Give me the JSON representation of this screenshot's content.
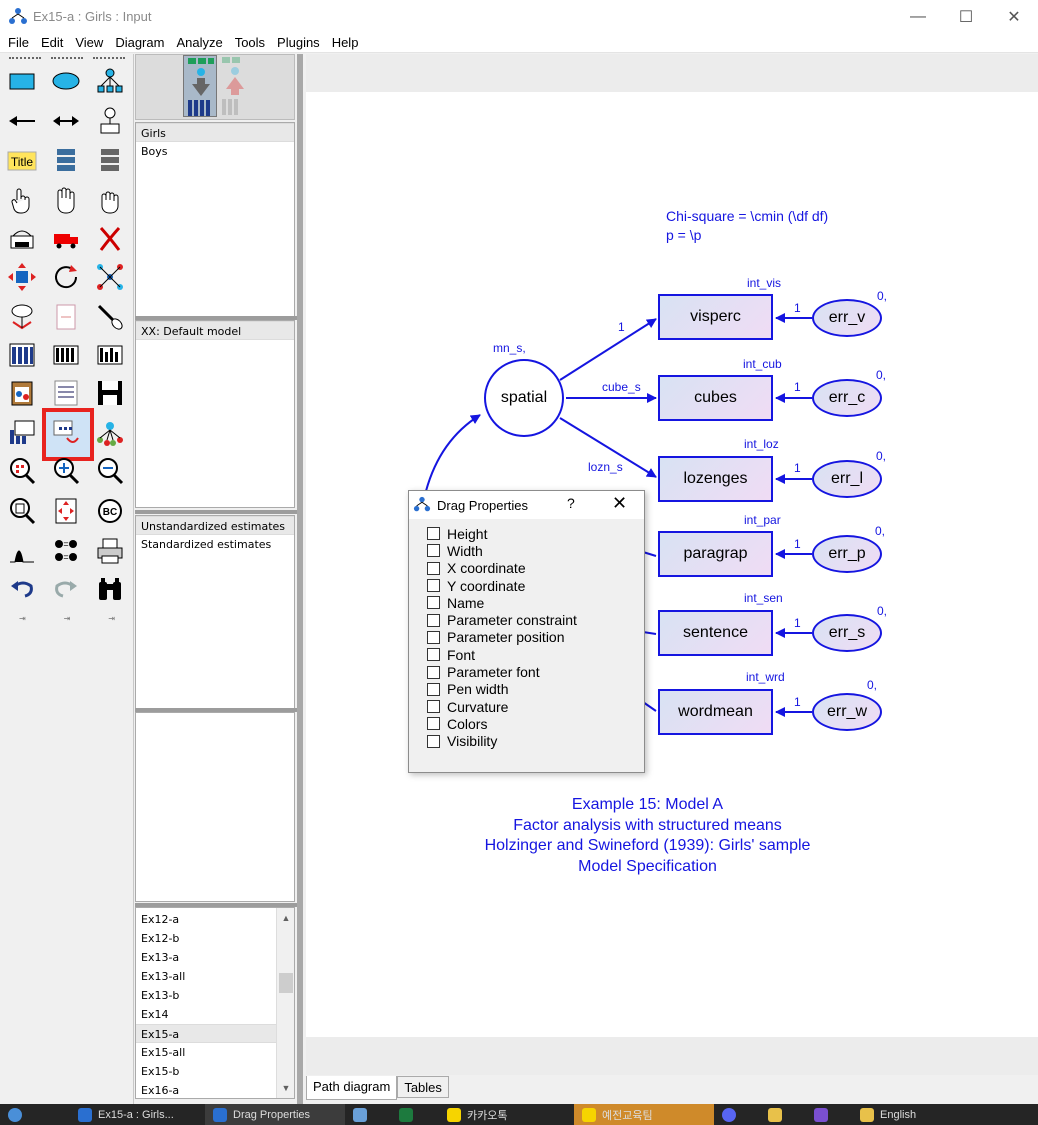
{
  "window": {
    "title": "Ex15-a : Girls : Input",
    "minimize": "—",
    "maximize": "☐",
    "close": "✕"
  },
  "menu": [
    "File",
    "Edit",
    "View",
    "Diagram",
    "Analyze",
    "Tools",
    "Plugins",
    "Help"
  ],
  "toolbox": {
    "title_tool_label": "Title",
    "bcd_tool_label": "BC"
  },
  "groups": {
    "items": [
      "Girls",
      "Boys"
    ]
  },
  "models": {
    "items": [
      "XX: Default model"
    ]
  },
  "estimates": {
    "items": [
      "Unstandardized estimates",
      "Standardized estimates"
    ]
  },
  "files": {
    "items": [
      "Ex12-a",
      "Ex12-b",
      "Ex13-a",
      "Ex13-all",
      "Ex13-b",
      "Ex14",
      "Ex15-a",
      "Ex15-all",
      "Ex15-b",
      "Ex16-a"
    ],
    "selected": "Ex15-a"
  },
  "diagram": {
    "chi_line1": "Chi-square = \\cmin (\\df df)",
    "chi_line2": "p = \\p",
    "latent": {
      "name": "spatial",
      "label": "mn_s,"
    },
    "paths": [
      "1",
      "cube_s",
      "lozn_s"
    ],
    "observed": [
      {
        "name": "visperc",
        "intercept": "int_vis",
        "error": "err_v",
        "err_mean": "0,",
        "weight": "1"
      },
      {
        "name": "cubes",
        "intercept": "int_cub",
        "error": "err_c",
        "err_mean": "0,",
        "weight": "1"
      },
      {
        "name": "lozenges",
        "intercept": "int_loz",
        "error": "err_l",
        "err_mean": "0,",
        "weight": "1"
      },
      {
        "name": "paragrap",
        "intercept": "int_par",
        "error": "err_p",
        "err_mean": "0,",
        "weight": "1"
      },
      {
        "name": "sentence",
        "intercept": "int_sen",
        "error": "err_s",
        "err_mean": "0,",
        "weight": "1"
      },
      {
        "name": "wordmean",
        "intercept": "int_wrd",
        "error": "err_w",
        "err_mean": "0,",
        "weight": "1"
      }
    ],
    "caption": [
      "Example 15: Model A",
      "Factor analysis with structured means",
      "Holzinger and Swineford (1939):  Girls' sample",
      "Model Specification"
    ]
  },
  "dialog": {
    "title": "Drag Properties",
    "help": "?",
    "close": "✕",
    "options": [
      "Height",
      "Width",
      "X coordinate",
      "Y coordinate",
      "Name",
      "Parameter constraint",
      "Parameter position",
      "Font",
      "Parameter font",
      "Pen width",
      "Curvature",
      "Colors",
      "Visibility"
    ]
  },
  "tabs": [
    "Path diagram",
    "Tables"
  ],
  "taskbar": [
    "Ex15-a : Girls...",
    "Drag Properties",
    "",
    "",
    "카카오톡",
    "예전교육팀",
    "",
    "",
    "",
    "English"
  ],
  "colors": {
    "diagram_blue": "#1515e0",
    "selection_red": "#e8231f",
    "taskbar": "#252525"
  }
}
